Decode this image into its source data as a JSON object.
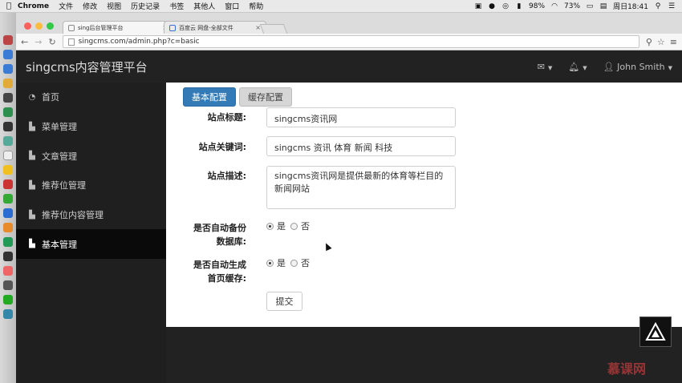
{
  "menubar": {
    "app": "Chrome",
    "items": [
      "文件",
      "修改",
      "视图",
      "历史记录",
      "书签",
      "其他人",
      "窗口",
      "帮助"
    ],
    "battery_a": "98%",
    "battery_b": "73%",
    "clock": "周日18:41"
  },
  "browser": {
    "tabs": [
      {
        "label": "sing后台管理平台",
        "active": true
      },
      {
        "label": "百度云 网盘-全部文件",
        "active": false
      }
    ],
    "url": "singcms.com/admin.php?c=basic"
  },
  "navbar": {
    "brand": "singcms内容管理平台",
    "user": "John Smith"
  },
  "sidebar": {
    "items": [
      {
        "label": "首页",
        "icon": "dashboard-icon"
      },
      {
        "label": "菜单管理",
        "icon": "bar-chart-icon"
      },
      {
        "label": "文章管理",
        "icon": "bar-chart-icon"
      },
      {
        "label": "推荐位管理",
        "icon": "bar-chart-icon"
      },
      {
        "label": "推荐位内容管理",
        "icon": "bar-chart-icon"
      },
      {
        "label": "基本管理",
        "icon": "bar-chart-icon",
        "active": true
      }
    ]
  },
  "content": {
    "tab_basic": "基本配置",
    "tab_cache": "缓存配置",
    "title_label": "站点标题:",
    "title_value": "singcms资讯网",
    "keywords_label": "站点关键词:",
    "keywords_value": "singcms  资讯 体育 新闻 科技",
    "desc_label": "站点描述:",
    "desc_value": "singcms资讯网是提供最新的体育等栏目的新闻网站",
    "backup_label_1": "是否自动备份",
    "backup_label_2": "数据库:",
    "cache_label_1": "是否自动生成",
    "cache_label_2": "首页缓存:",
    "yes": "是",
    "no": "否",
    "submit": "提交"
  },
  "watermark": "慕课网",
  "colors": {
    "primary": "#337ab7",
    "navbar": "#222222",
    "sidebar_active": "#0a0a0a"
  }
}
